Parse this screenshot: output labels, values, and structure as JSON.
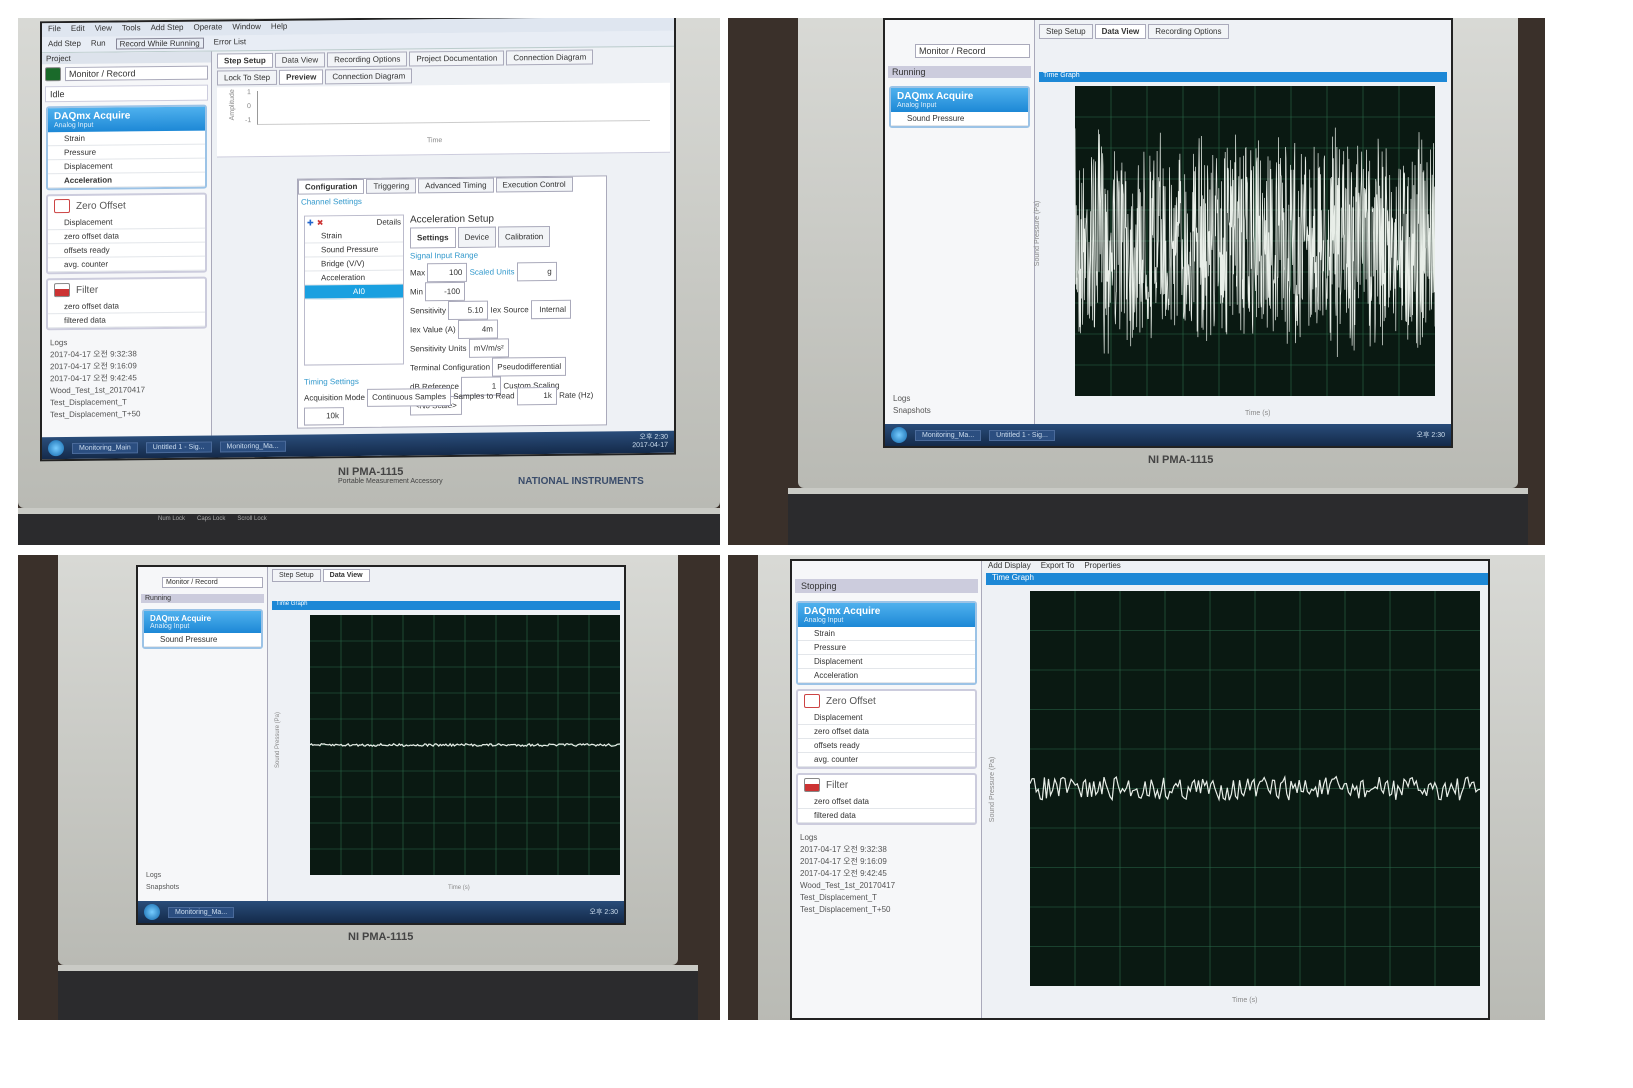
{
  "app": {
    "menu": [
      "File",
      "Edit",
      "View",
      "Tools",
      "Add Step",
      "Operate",
      "Window",
      "Help"
    ],
    "toolbar": [
      "Add Step",
      "Run",
      "Record While Running",
      "Error List"
    ],
    "project_label": "Project",
    "mode": "Monitor / Record",
    "status_idle": "Idle",
    "status_running": "Running",
    "status_stopping": "Stopping",
    "main_tabs": [
      "Step Setup",
      "Data View",
      "Recording Options",
      "Project Documentation",
      "Connection Diagram"
    ],
    "sub_tabs": [
      "Lock To Step",
      "Preview",
      "Connection Diagram"
    ],
    "data_view_toolbar": [
      "Add Display",
      "Export To",
      "Properties"
    ],
    "graph_title": "Time Graph",
    "graph_ylabel": "Sound Pressure (Pa)",
    "graph_xlabel": "Time (s)",
    "preview_ylabel": "Amplitude",
    "preview_xlabel": "Time",
    "preview_yticks": [
      "1",
      "0",
      "-1"
    ]
  },
  "steps": {
    "daq": {
      "title": "DAQmx Acquire",
      "subtitle": "Analog Input",
      "channels": [
        "Strain",
        "Pressure",
        "Displacement",
        "Acceleration"
      ],
      "sound_channel": "Sound Pressure"
    },
    "zero": {
      "title": "Zero Offset",
      "rows": [
        "Displacement",
        "zero offset data",
        "offsets ready",
        "avg. counter"
      ]
    },
    "filter": {
      "title": "Filter",
      "rows": [
        "zero offset data",
        "filtered data"
      ]
    }
  },
  "logs": {
    "title": "Logs",
    "items": [
      "2017-04-17 오전 9:32:38",
      "2017-04-17 오전 9:16:09",
      "2017-04-17 오전 9:42:45",
      "Wood_Test_1st_20170417",
      "Test_Displacement_T",
      "Test_Displacement_T+50"
    ],
    "snapshots": "Snapshots"
  },
  "config": {
    "tabs": [
      "Configuration",
      "Triggering",
      "Advanced Timing",
      "Execution Control"
    ],
    "channel_settings": "Channel Settings",
    "details": "Details",
    "channel_tree": [
      "Strain",
      "Sound Pressure",
      "Bridge (V/V)",
      "Acceleration",
      "AI0"
    ],
    "setup_title": "Acceleration Setup",
    "setup_tabs": [
      "Settings",
      "Device",
      "Calibration"
    ],
    "signal_range": "Signal Input Range",
    "max_label": "Max",
    "max_value": "100",
    "min_label": "Min",
    "min_value": "-100",
    "scaled_units_label": "Scaled Units",
    "scaled_units": "g",
    "sensitivity_label": "Sensitivity",
    "sensitivity": "5.10",
    "iex_source_label": "Iex Source",
    "iex_source": "Internal",
    "iex_value_label": "Iex Value (A)",
    "iex_value": "4m",
    "sens_units_label": "Sensitivity Units",
    "sens_units": "mV/m/s²",
    "terminal_label": "Terminal Configuration",
    "terminal": "Pseudodifferential",
    "dbref_label": "dB Reference",
    "dbref": "1",
    "scaling_label": "Custom Scaling",
    "scaling": "<No Scale>",
    "timing": "Timing Settings",
    "acq_mode_label": "Acquisition Mode",
    "acq_mode": "Continuous Samples",
    "samples_label": "Samples to Read",
    "samples": "1k",
    "rate_label": "Rate (Hz)",
    "rate": "10k"
  },
  "taskbar": {
    "items": [
      "Monitoring_Main",
      "Untitled 1 - Sig...",
      "Monitoring_Ma..."
    ],
    "time": "오후 2:30",
    "date": "2017-04-17"
  },
  "hardware": {
    "model": "NI PMA-1115",
    "model_sub": "Portable Measurement Accessory",
    "brand": "NATIONAL INSTRUMENTS",
    "keys": [
      "Num Lock",
      "Caps Lock",
      "Scroll Lock"
    ]
  },
  "colors": {
    "accent": "#1d88d6",
    "graph_bg": "#0a1912",
    "trace": "#e8eee8",
    "grid": "#2a6a4a"
  },
  "chart_data": [
    {
      "type": "line",
      "title": "Time Graph",
      "panel": "top-right",
      "ylabel": "Sound Pressure (Pa)",
      "xlabel": "Time (s)",
      "description_level": "large noise",
      "amplitude": 0.75
    },
    {
      "type": "line",
      "title": "Time Graph",
      "panel": "bottom-left",
      "ylabel": "Sound Pressure (Pa)",
      "xlabel": "Time (s)",
      "amplitude": 0.01
    },
    {
      "type": "line",
      "title": "Time Graph",
      "panel": "bottom-right",
      "ylabel": "Sound Pressure (Pa)",
      "xlabel": "Time (s)",
      "amplitude": 0.06
    }
  ]
}
